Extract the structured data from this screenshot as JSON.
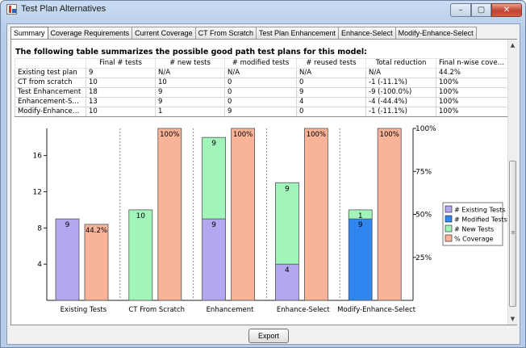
{
  "window": {
    "title": "Test Plan Alternatives",
    "controls": {
      "minimize": "–",
      "maximize": "▢",
      "close": "✕"
    }
  },
  "tabs": [
    {
      "label": "Summary",
      "active": true
    },
    {
      "label": "Coverage Requirements"
    },
    {
      "label": "Current Coverage"
    },
    {
      "label": "CT From Scratch"
    },
    {
      "label": "Test Plan Enhancement"
    },
    {
      "label": "Enhance-Select"
    },
    {
      "label": "Modify-Enhance-Select"
    }
  ],
  "summary": {
    "heading": "The following table summarizes the possible good path test plans for this model:",
    "table": {
      "headers": [
        "",
        "Final # tests",
        "# new tests",
        "# modified tests",
        "# reused tests",
        "Total reduction",
        "Final n-wise cover..."
      ],
      "rows": [
        [
          "Existing test plan",
          "9",
          "N/A",
          "N/A",
          "N/A",
          "N/A",
          "44.2%"
        ],
        [
          "CT from scratch",
          "10",
          "10",
          "0",
          "0",
          "-1 (-11.1%)",
          "100%"
        ],
        [
          "Test Enhancement",
          "18",
          "9",
          "0",
          "9",
          "-9 (-100.0%)",
          "100%"
        ],
        [
          "Enhancement-Select",
          "13",
          "9",
          "0",
          "4",
          "-4 (-44.4%)",
          "100%"
        ],
        [
          "Modify-Enhanceme...",
          "10",
          "1",
          "9",
          "0",
          "-1 (-11.1%)",
          "100%"
        ]
      ]
    }
  },
  "chart_data": {
    "type": "bar",
    "categories": [
      "Existing Tests",
      "CT From Scratch",
      "Enhancement",
      "Enhance-Select",
      "Modify-Enhance-Select"
    ],
    "series": [
      {
        "name": "# Existing Tests",
        "color": "#b4a7f0",
        "values": [
          9,
          0,
          9,
          4,
          0
        ],
        "axis": "left"
      },
      {
        "name": "# Modified Tests",
        "color": "#2f86ee",
        "values": [
          0,
          0,
          0,
          0,
          9
        ],
        "axis": "left"
      },
      {
        "name": "# New Tests",
        "color": "#a2f5ba",
        "values": [
          0,
          10,
          9,
          9,
          1
        ],
        "axis": "left"
      },
      {
        "name": "% Coverage",
        "color": "#f8b398",
        "values": [
          44.2,
          100,
          100,
          100,
          100
        ],
        "axis": "right"
      }
    ],
    "bar_labels": {
      "stacked": [
        [
          "9"
        ],
        [
          "10"
        ],
        [
          "9",
          "9"
        ],
        [
          "4",
          "9"
        ],
        [
          "9",
          "1"
        ]
      ],
      "coverage": [
        "44.2%",
        "100%",
        "100%",
        "100%",
        "100%"
      ]
    },
    "y_left": {
      "ticks": [
        4,
        8,
        12,
        16
      ],
      "range": [
        0,
        19
      ]
    },
    "y_right": {
      "ticks": [
        "25%",
        "50%",
        "75%",
        "100%"
      ],
      "range": [
        0,
        100
      ]
    },
    "legend_position": "right"
  },
  "footer": {
    "export_label": "Export"
  },
  "scrollbar": {
    "up": "▲",
    "down": "▼",
    "grip": "≡"
  }
}
